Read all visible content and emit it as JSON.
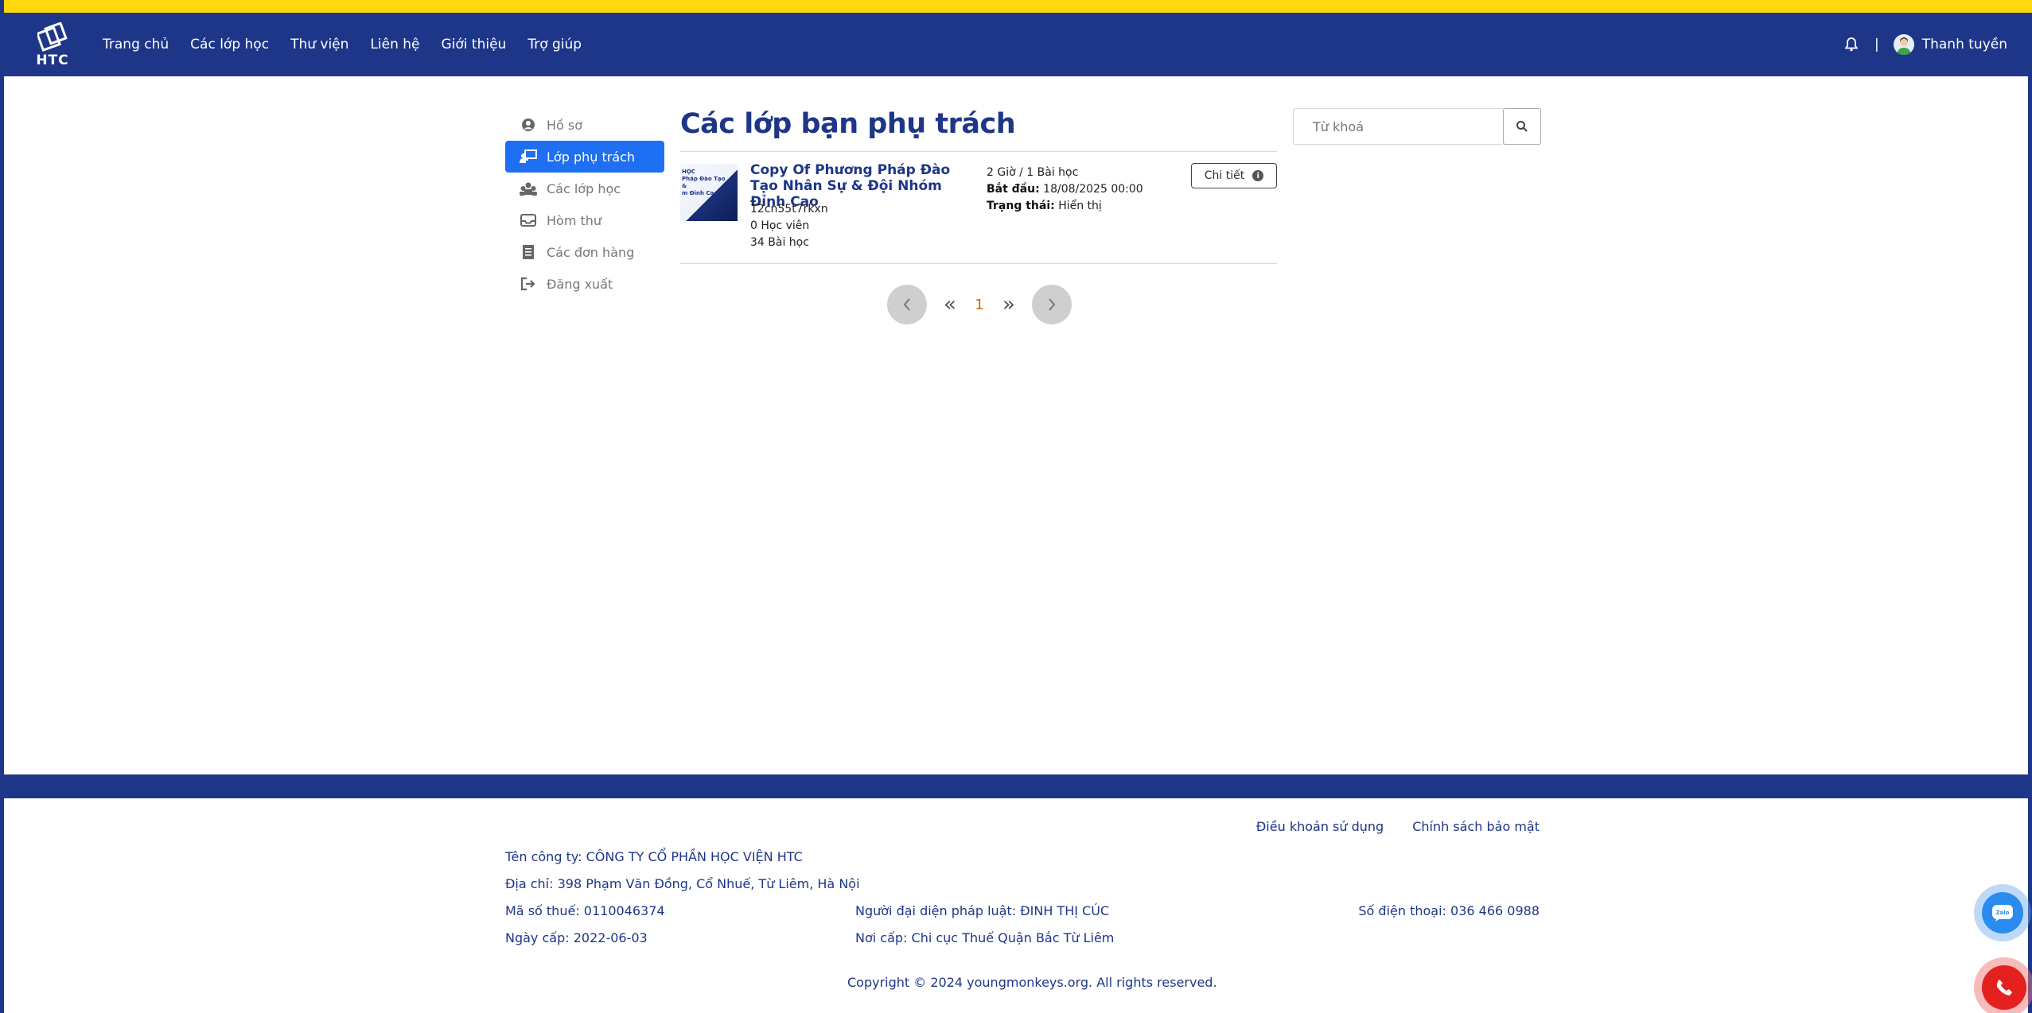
{
  "nav": {
    "logo_text": "HTC",
    "links": [
      "Trang chủ",
      "Các lớp học",
      "Thư viện",
      "Liên hệ",
      "Giới thiệu",
      "Trợ giúp"
    ],
    "separator": "|",
    "user_name": "Thanh tuyền"
  },
  "sidebar": {
    "items": [
      {
        "label": "Hồ sơ",
        "icon": "user-circle-icon"
      },
      {
        "label": "Lớp phụ trách",
        "icon": "teacher-board-icon",
        "active": true
      },
      {
        "label": "Các lớp học",
        "icon": "people-group-icon"
      },
      {
        "label": "Hòm thư",
        "icon": "inbox-icon"
      },
      {
        "label": "Các đơn hàng",
        "icon": "receipt-icon"
      },
      {
        "label": "Đăng xuất",
        "icon": "logout-icon"
      }
    ]
  },
  "main": {
    "title": "Các lớp bạn phụ trách",
    "course": {
      "thumb_text": "HỌC\nPháp Đào Tạo\n& \nm Đỉnh Cao",
      "title": "Copy Of Phương Pháp Đào Tạo Nhân Sự & Đội Nhóm Đỉnh Cao",
      "code": "12cn55t7rkxn",
      "students": "0 Học viên",
      "lessons": "34 Bài học",
      "duration": "2 Giờ / 1 Bài học",
      "start_label": "Bắt đầu:",
      "start_value": "18/08/2025 00:00",
      "status_label": "Trạng thái:",
      "status_value": "Hiển thị",
      "detail_label": "Chi tiết"
    },
    "pager": {
      "first": "«",
      "current": "1",
      "last": "»"
    }
  },
  "search": {
    "placeholder": "Từ khoá"
  },
  "footer": {
    "links": [
      "Điều khoản sử dụng",
      "Chính sách bảo mật"
    ],
    "company": "Tên công ty: CÔNG TY CỔ PHẦN HỌC VIỆN HTC",
    "address": "Địa chỉ: 398 Phạm Văn Đồng, Cổ Nhuế, Từ Liêm, Hà Nội",
    "tax_code": "Mã số thuế: 0110046374",
    "legal_rep": "Người đại diện pháp luật: ĐINH THỊ CÚC",
    "phone": "Số điện thoại: 036 466 0988",
    "issue_date": "Ngày cấp: 2022-06-03",
    "issue_place": "Nơi cấp: Chi cục Thuế Quận Bắc Từ Liêm",
    "copyright": "Copyright © 2024 youngmonkeys.org. All rights reserved."
  },
  "colors": {
    "brand_blue": "#1d3688",
    "accent_yellow": "#fcd80c",
    "active_blue": "#1e6ff1",
    "call_red": "#e5211f",
    "zalo_blue": "#2a8cf0"
  }
}
